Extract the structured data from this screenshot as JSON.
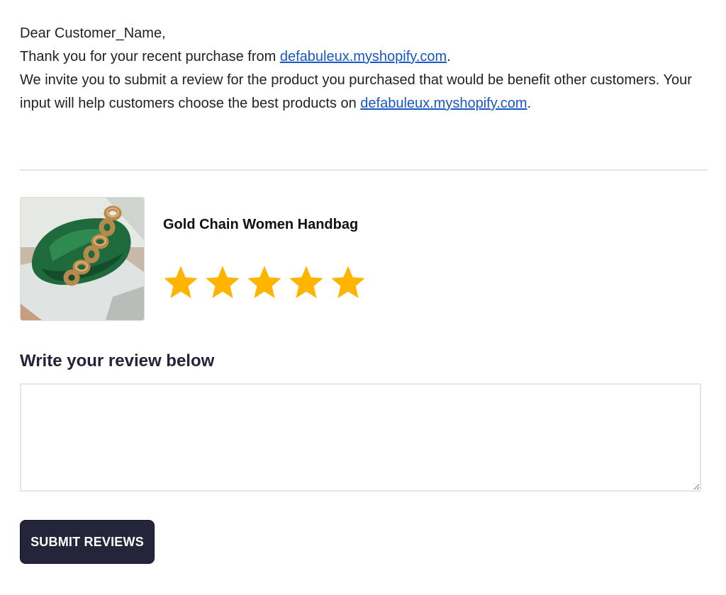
{
  "letter": {
    "greeting": "Dear Customer_Name,",
    "line1_before": "Thank you for your recent purchase from ",
    "store_link": "defabuleux.myshopify.com",
    "line1_after": ".",
    "line2_before": "We invite you to submit a review for the product you purchased that would be benefit other customers. Your input will help customers choose the best products on ",
    "line2_after": "."
  },
  "product": {
    "name": "Gold Chain Women Handbag",
    "image_icon": "green-handbag-photo"
  },
  "rating": {
    "value": 5,
    "max": 5,
    "star_color": "#ffb400",
    "star_icon": "star-icon"
  },
  "review": {
    "label": "Write your review below",
    "value": "",
    "placeholder": ""
  },
  "submit": {
    "label": "SUBMIT REVIEWS",
    "background": "#24243a",
    "text_color": "#ffffff"
  },
  "colors": {
    "link": "#1a56c4",
    "divider": "#e4e4e4"
  }
}
